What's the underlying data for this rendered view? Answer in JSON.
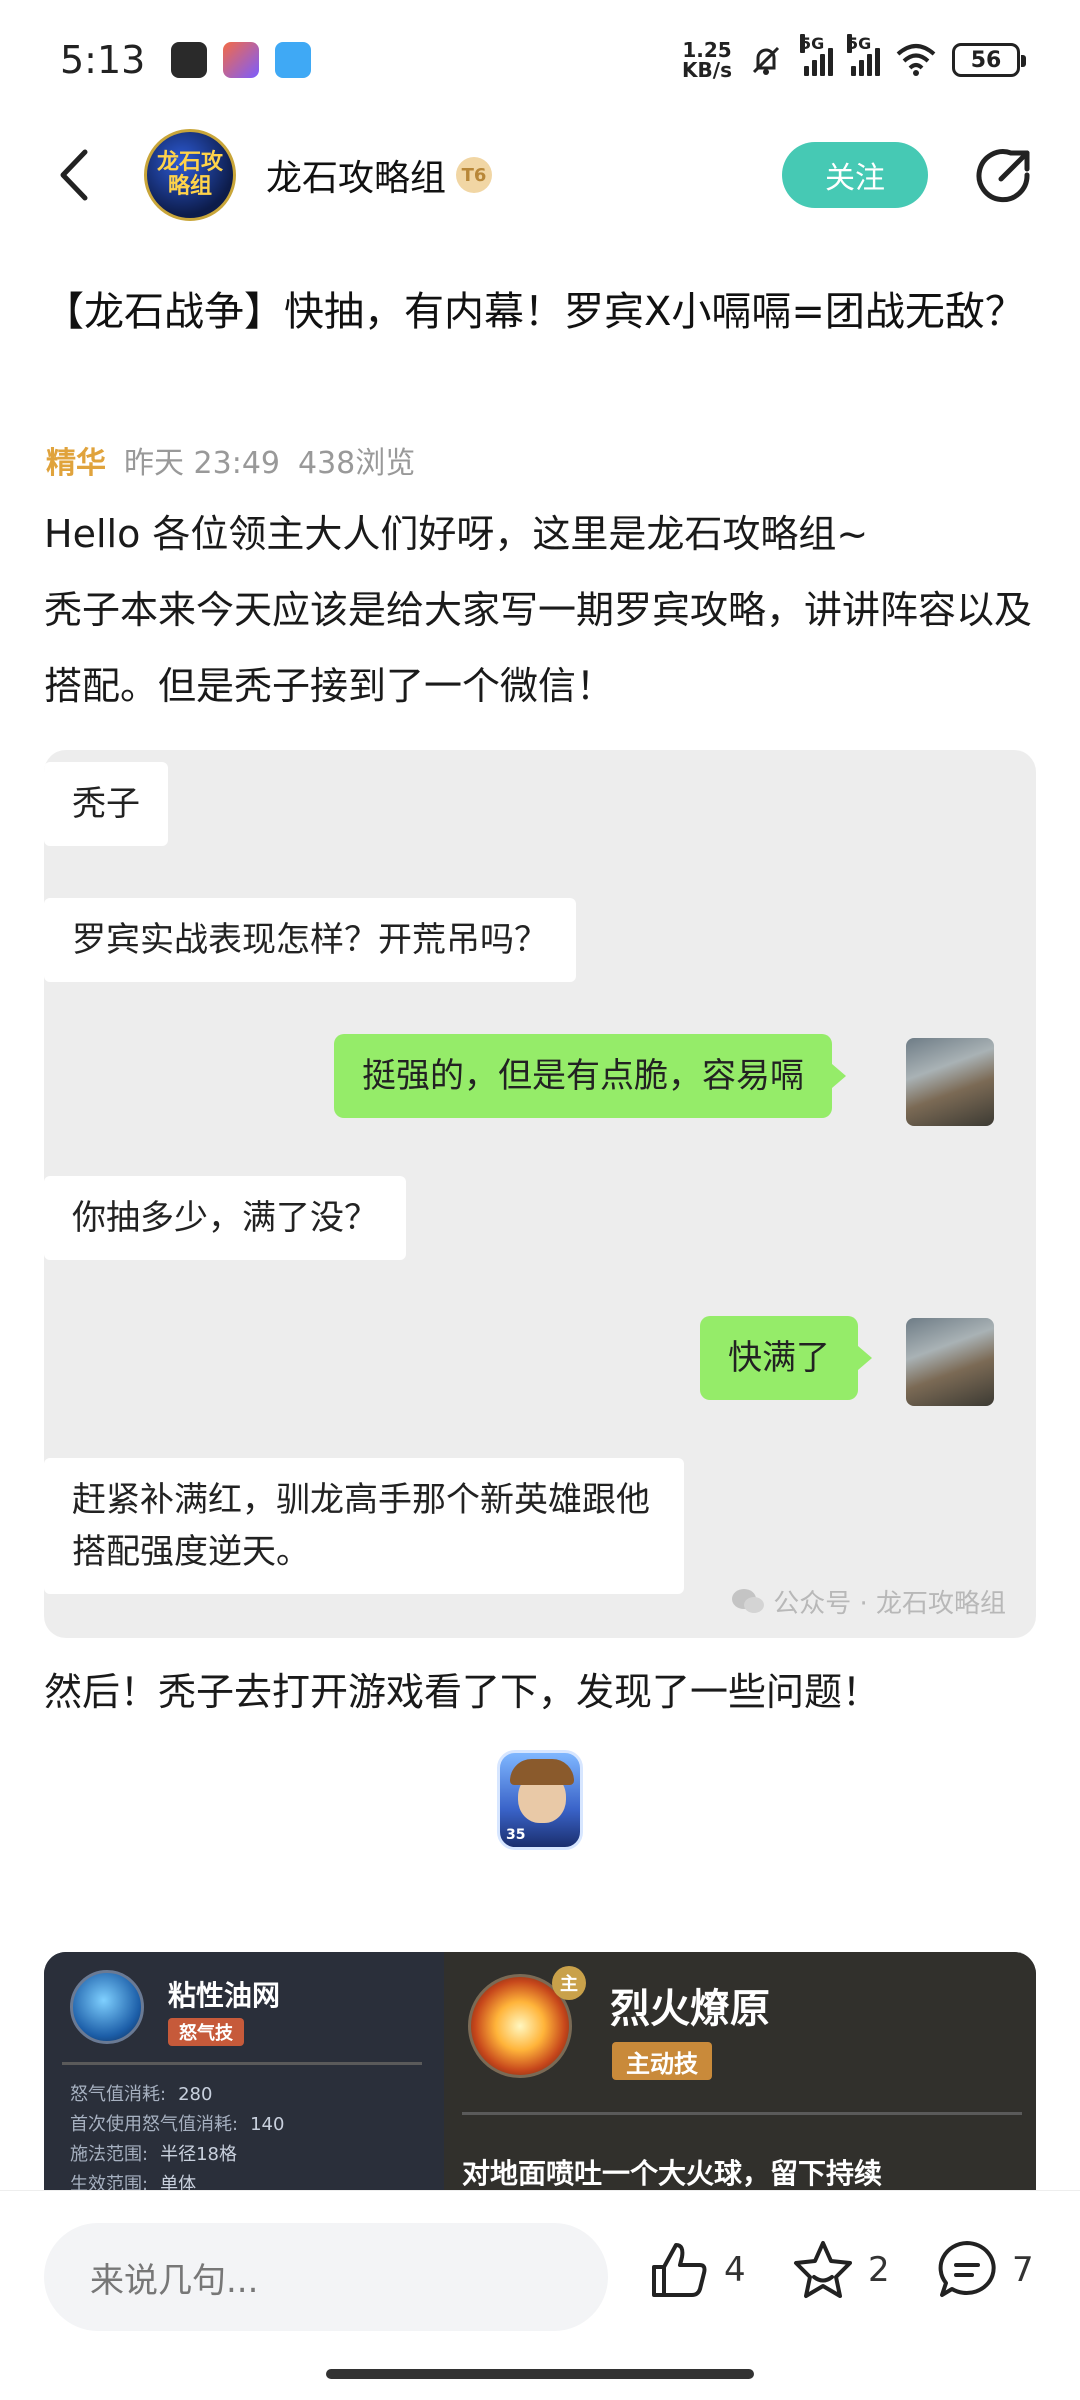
{
  "status_bar": {
    "time": "5:13",
    "net_speed_value": "1.25",
    "net_speed_unit": "KB/s",
    "signal1_label": "5G",
    "signal2_label": "5G",
    "battery": "56",
    "icons": [
      "mute-icon",
      "wifi-icon"
    ]
  },
  "header": {
    "avatar_text": "龙石攻略组",
    "account_name": "龙石攻略组",
    "level_badge": "T6",
    "follow_label": "关注"
  },
  "article": {
    "title": "【龙石战争】快抽，有内幕！罗宾X小嗝嗝=团战无敌？",
    "tag": "精华",
    "time": "昨天 23:49",
    "views": "438浏览",
    "para1": "Hello 各位领主大人们好呀，这里是龙石攻略组~",
    "para2": "秃子本来今天应该是给大家写一期罗宾攻略，讲讲阵容以及搭配。但是秃子接到了一个微信！",
    "para3": "然后！秃子去打开游戏看了下，发现了一些问题！"
  },
  "chat": {
    "messages": [
      {
        "side": "left",
        "text": "秃子"
      },
      {
        "side": "left",
        "text": "罗宾实战表现怎样？开荒吊吗？"
      },
      {
        "side": "right",
        "text": "挺强的，但是有点脆，容易嗝"
      },
      {
        "side": "left",
        "text": "你抽多少，满了没？"
      },
      {
        "side": "right",
        "text": "快满了"
      },
      {
        "side": "left",
        "text": "赶紧补满红，驯龙高手那个新英雄跟他搭配强度逆天。"
      }
    ],
    "watermark": "公众号 · 龙石攻略组"
  },
  "hero": {
    "level": "35"
  },
  "skill_card": {
    "left": {
      "name": "粘性油网",
      "type": "怒气技",
      "stats": [
        {
          "label": "怒气值消耗:",
          "value": "280"
        },
        {
          "label": "首次使用怒气值消耗:",
          "value": "140"
        },
        {
          "label": "施法范围:",
          "value": "半径18格"
        },
        {
          "label": "生效范围:",
          "value": "单体"
        }
      ]
    },
    "right": {
      "badge": "主",
      "name": "烈火燎原",
      "type": "主动技",
      "desc": "对地面喷吐一个大火球，留下持续"
    }
  },
  "bottom_bar": {
    "comment_placeholder": "来说几句...",
    "like_count": "4",
    "fav_count": "2",
    "comment_count": "7"
  },
  "colors": {
    "accent": "#46c9b4",
    "tag": "#e0a33c",
    "wechat_green": "#95ec69"
  }
}
